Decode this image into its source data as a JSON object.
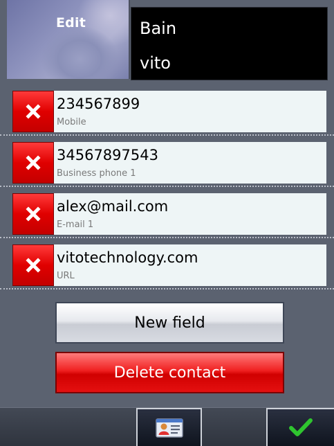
{
  "header": {
    "edit_label": "Edit",
    "first_name": "Bain",
    "last_name": "vito"
  },
  "fields": [
    {
      "value": "234567899",
      "label": "Mobile"
    },
    {
      "value": "34567897543",
      "label": "Business phone 1"
    },
    {
      "value": "alex@mail.com",
      "label": "E-mail 1"
    },
    {
      "value": "vitotechnology.com",
      "label": "URL"
    }
  ],
  "actions": {
    "new_field_label": "New field",
    "delete_contact_label": "Delete contact"
  },
  "toolbar": {
    "items": [
      {
        "icon": "contact-card-icon"
      },
      {
        "icon": "checkmark-icon"
      }
    ]
  },
  "colors": {
    "background": "#5b6270",
    "delete_red": "#e00000",
    "field_bg": "#eef5f6",
    "check_green": "#2fc42f"
  }
}
